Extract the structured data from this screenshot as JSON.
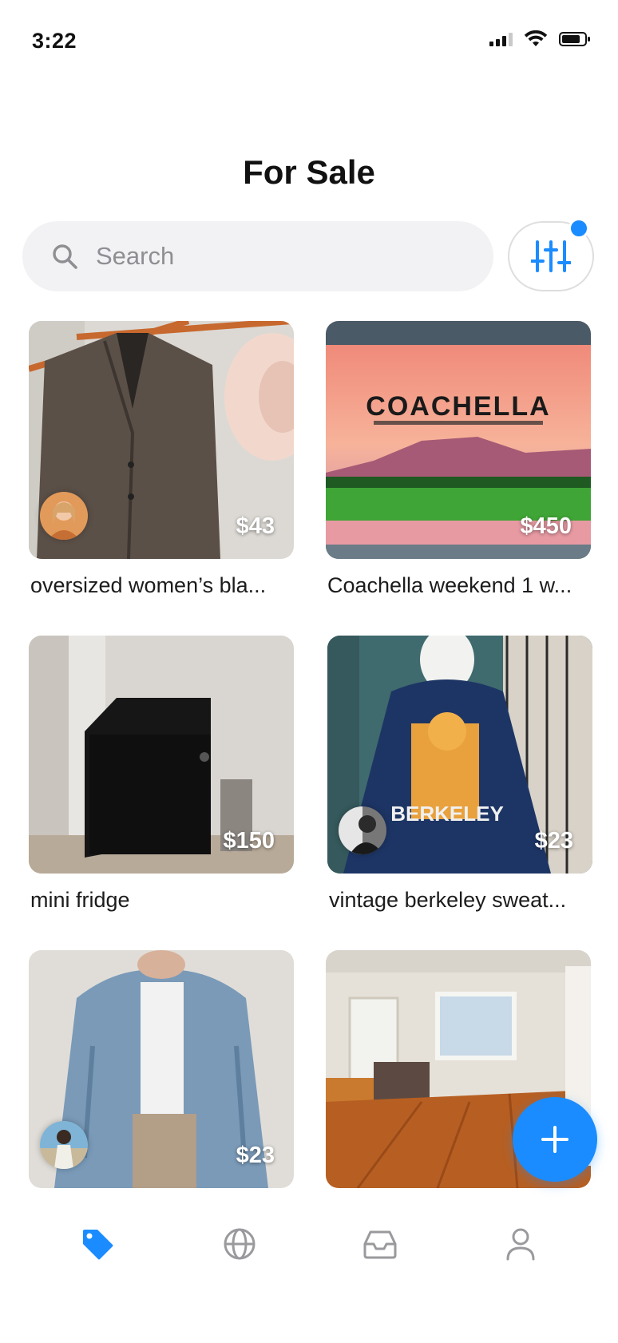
{
  "status_bar": {
    "time": "3:22"
  },
  "header": {
    "title": "For Sale"
  },
  "search": {
    "placeholder": "Search"
  },
  "filter": {
    "has_indicator": true
  },
  "colors": {
    "accent": "#1a8cff",
    "search_bg": "#f2f2f4",
    "inactive_icon": "#9a9a9e"
  },
  "listings": [
    {
      "title": "oversized women’s bla...",
      "price": "$43",
      "has_avatar": true
    },
    {
      "title": "Coachella weekend 1 w...",
      "price": "$450",
      "has_avatar": false
    },
    {
      "title": "mini fridge",
      "price": "$150",
      "has_avatar": false
    },
    {
      "title": "vintage berkeley sweat...",
      "price": "$23",
      "has_avatar": true
    },
    {
      "title": "",
      "price": "$23",
      "has_avatar": true
    },
    {
      "title": "",
      "price": "",
      "has_avatar": false
    }
  ],
  "tab_bar": {
    "tabs": [
      {
        "icon": "tag-icon",
        "active": true
      },
      {
        "icon": "globe-icon",
        "active": false
      },
      {
        "icon": "inbox-icon",
        "active": false
      },
      {
        "icon": "person-icon",
        "active": false
      }
    ]
  },
  "fab": {
    "icon": "plus-icon"
  }
}
